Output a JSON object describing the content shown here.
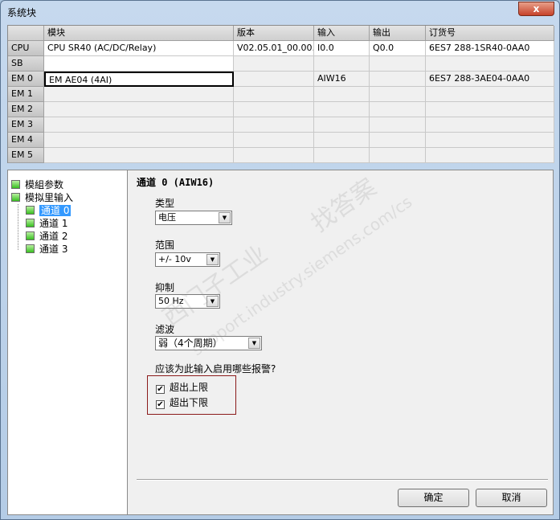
{
  "window": {
    "title": "系统块",
    "close_label": "x"
  },
  "grid": {
    "headers": [
      "",
      "模块",
      "版本",
      "输入",
      "输出",
      "订货号"
    ],
    "rows": [
      [
        "CPU",
        "CPU SR40 (AC/DC/Relay)",
        "V02.05.01_00.00...",
        "I0.0",
        "Q0.0",
        "6ES7 288-1SR40-0AA0"
      ],
      [
        "SB",
        "",
        "",
        "",
        "",
        ""
      ],
      [
        "EM 0",
        "EM AE04 (4AI)",
        "",
        "AIW16",
        "",
        "6ES7 288-3AE04-0AA0"
      ],
      [
        "EM 1",
        "",
        "",
        "",
        "",
        ""
      ],
      [
        "EM 2",
        "",
        "",
        "",
        "",
        ""
      ],
      [
        "EM 3",
        "",
        "",
        "",
        "",
        ""
      ],
      [
        "EM 4",
        "",
        "",
        "",
        "",
        ""
      ],
      [
        "EM 5",
        "",
        "",
        "",
        "",
        ""
      ]
    ]
  },
  "tree": {
    "items": [
      "模組参数",
      "模拟里输入",
      "通道 0",
      "通道 1",
      "通道 2",
      "通道 3"
    ],
    "selected": "通道 0"
  },
  "panel": {
    "heading": "通道 0 (AIW16)",
    "type_label": "类型",
    "type_value": "电压",
    "range_label": "范围",
    "range_value": "+/- 10v",
    "suppress_label": "抑制",
    "suppress_value": "50 Hz",
    "filter_label": "滤波",
    "filter_value": "弱（4个周期）",
    "alarm_question": "应该为此输入启用哪些报警?",
    "alarms": [
      {
        "label": "超出上限",
        "checked": true
      },
      {
        "label": "超出下限",
        "checked": true
      }
    ]
  },
  "buttons": {
    "ok": "确定",
    "cancel": "取消"
  },
  "watermark": [
    "西门子工业",
    "support.industry.siemens.com/cs",
    "找答案"
  ]
}
